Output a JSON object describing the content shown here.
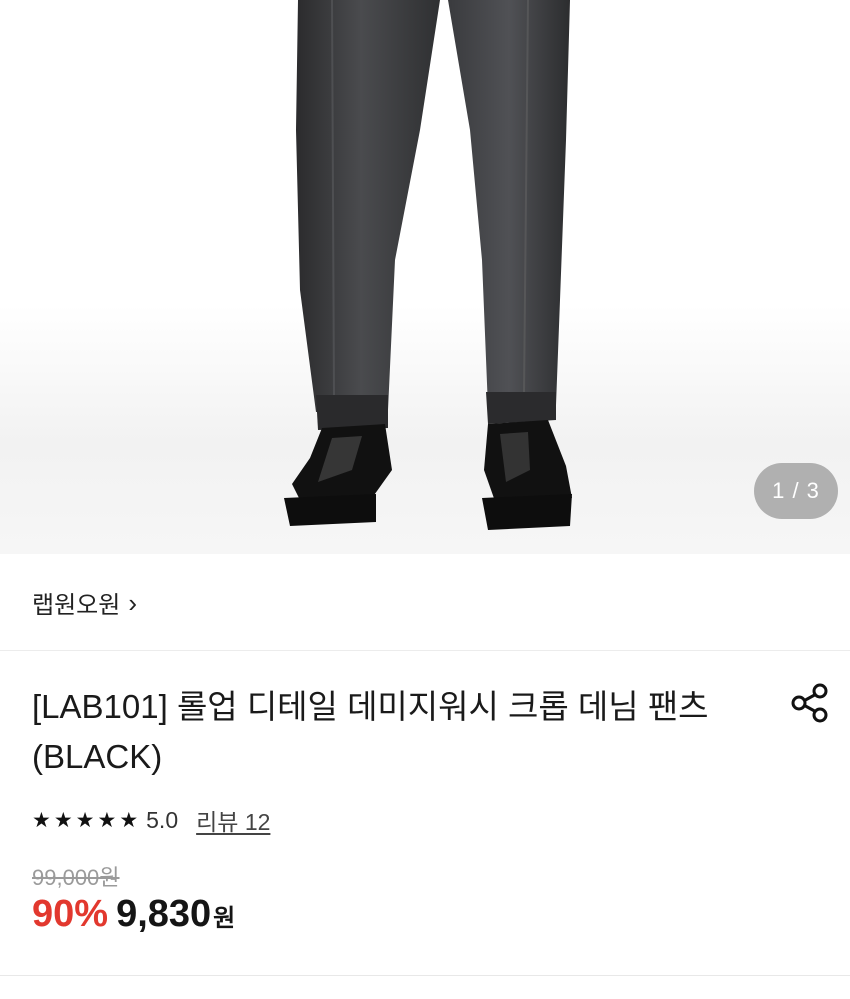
{
  "gallery": {
    "counter": "1 / 3",
    "image_description": "product-photo-black-denim-pants"
  },
  "brand": {
    "name": "랩원오원",
    "chevron": "›"
  },
  "product": {
    "title_line1": "[LAB101] 롤업 디테일 데미지워시 크롭 데님 팬츠",
    "title_line2": "(BLACK)"
  },
  "rating": {
    "stars": [
      "★",
      "★",
      "★",
      "★",
      "★"
    ],
    "score": "5.0",
    "review_label": "리뷰 12"
  },
  "price": {
    "original": "99,000원",
    "discount": "90%",
    "current": "9,830",
    "currency": "원"
  },
  "colors": {
    "discount": "#e2382e",
    "text": "#151515",
    "muted": "#9a9a9a"
  },
  "icons": {
    "share": "share-icon"
  }
}
